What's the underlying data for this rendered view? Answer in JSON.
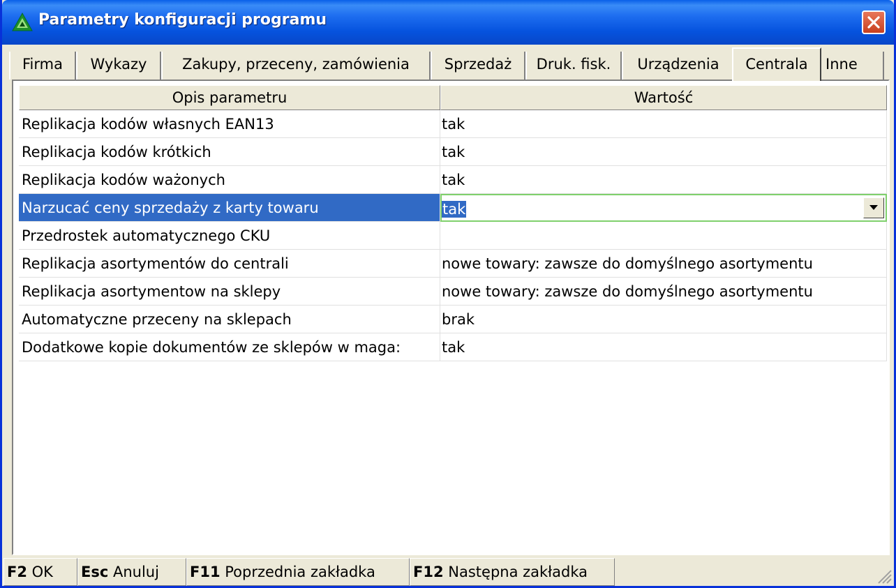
{
  "window": {
    "title": "Parametry konfiguracji programu"
  },
  "tabs": [
    {
      "label": "Firma"
    },
    {
      "label": "Wykazy"
    },
    {
      "label": "Zakupy, przeceny, zamówienia"
    },
    {
      "label": "Sprzedaż"
    },
    {
      "label": "Druk. fisk."
    },
    {
      "label": "Urządzenia"
    },
    {
      "label": "Centrala",
      "active": true
    },
    {
      "label": "Inne"
    }
  ],
  "grid": {
    "columns": [
      "Opis parametru",
      "Wartość"
    ],
    "rows": [
      {
        "desc": "Replikacja kodów własnych EAN13",
        "value": "tak"
      },
      {
        "desc": "Replikacja kodów krótkich",
        "value": "tak"
      },
      {
        "desc": "Replikacja kodów ważonych",
        "value": "tak"
      },
      {
        "desc": "Narzucać ceny sprzedaży z karty towaru",
        "value": "tak",
        "selected": true
      },
      {
        "desc": "Przedrostek automatycznego CKU",
        "value": ""
      },
      {
        "desc": "Replikacja asortymentów do centrali",
        "value": "nowe towary: zawsze do domyślnego asortymentu"
      },
      {
        "desc": "Replikacja asortymentow na sklepy",
        "value": "nowe towary: zawsze do domyślnego asortymentu"
      },
      {
        "desc": "Automatyczne przeceny na sklepach",
        "value": "brak"
      },
      {
        "desc": "Dodatkowe kopie dokumentów ze sklepów w maga:",
        "value": "tak"
      }
    ]
  },
  "statusbar": [
    {
      "key": "F2",
      "label": "OK"
    },
    {
      "key": "Esc",
      "label": "Anuluj"
    },
    {
      "key": "F11",
      "label": "Poprzednia zakładka"
    },
    {
      "key": "F12",
      "label": "Następna zakładka"
    }
  ],
  "colors": {
    "titlebar": "#0653DE",
    "selection": "#316AC5",
    "face": "#ECE9D8",
    "edit_border": "#7FD06C"
  }
}
